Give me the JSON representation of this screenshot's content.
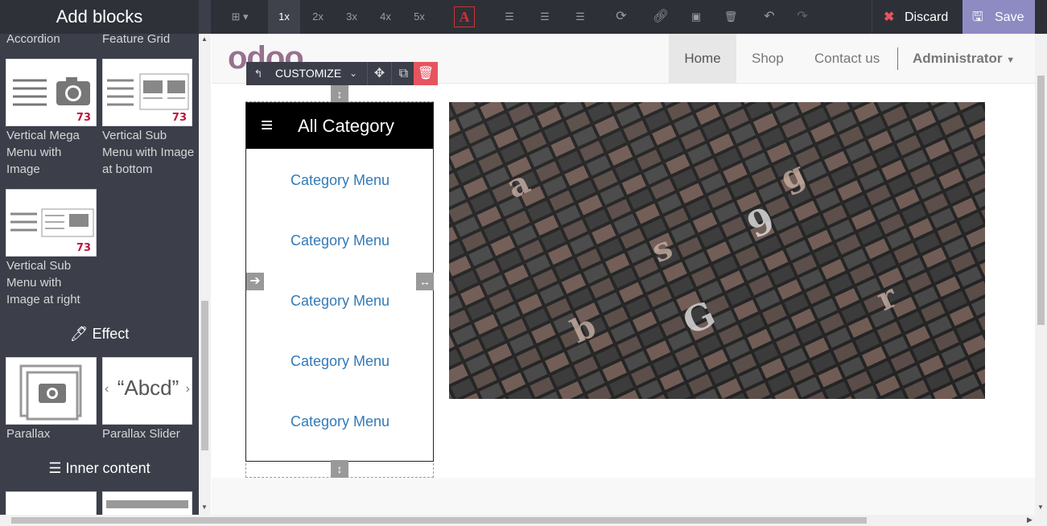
{
  "sidebar": {
    "title": "Add blocks",
    "top_labels": [
      "Accordion",
      "Feature Grid"
    ],
    "blocks": [
      {
        "label": "Vertical Mega Menu with Image",
        "badge": "73"
      },
      {
        "label": "Vertical Sub Menu with Image at bottom",
        "badge": "73"
      },
      {
        "label": "Vertical Sub Menu with Image at right",
        "badge": "73"
      }
    ],
    "effect_title": "Effect",
    "effect_blocks": [
      {
        "label": "Parallax"
      },
      {
        "label": "Parallax Slider"
      }
    ],
    "parallax_text": "“Abcd”",
    "inner_title": "Inner content"
  },
  "toolbar": {
    "zoom": [
      "1x",
      "2x",
      "3x",
      "4x",
      "5x"
    ],
    "discard_label": "Discard",
    "save_label": "Save"
  },
  "site": {
    "logo": "odoo",
    "nav": [
      "Home",
      "Shop",
      "Contact us"
    ],
    "user": "Administrator"
  },
  "customize": {
    "label": "CUSTOMIZE"
  },
  "category": {
    "title": "All Category",
    "items": [
      "Category Menu",
      "Category Menu",
      "Category Menu",
      "Category Menu",
      "Category Menu"
    ]
  },
  "colors": {
    "accent": "#8e8bc3",
    "danger": "#e6555f",
    "link": "#337ab7"
  }
}
